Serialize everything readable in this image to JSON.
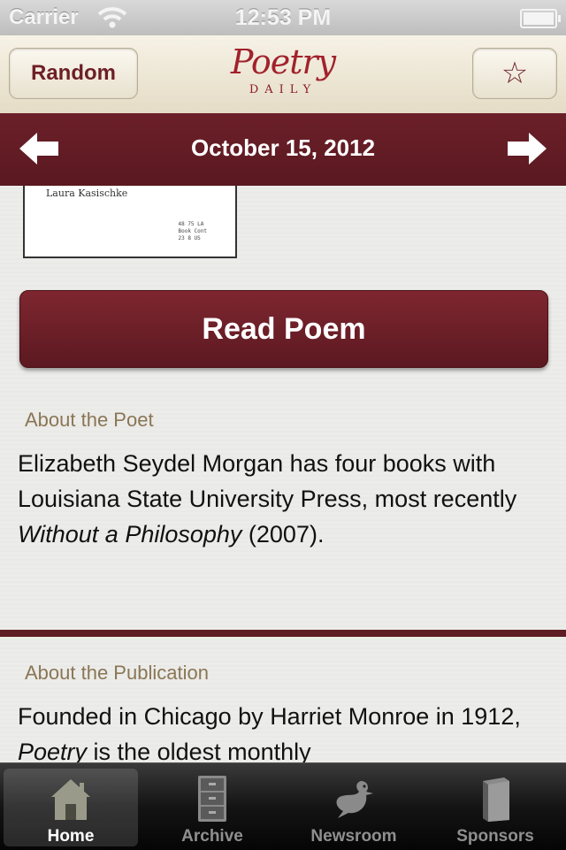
{
  "status_bar": {
    "carrier": "Carrier",
    "time": "12:53 PM"
  },
  "navbar": {
    "random_label": "Random",
    "star_glyph": "☆",
    "logo_word": "Poetry",
    "logo_sub": "DAILY"
  },
  "date_bar": {
    "date": "October 15, 2012"
  },
  "thumbnail": {
    "title": "Laura Kasischke",
    "meta_lines": [
      "48 75 LA",
      "Book Cont",
      "23 8 US"
    ]
  },
  "read_button": {
    "label": "Read Poem"
  },
  "about_poet": {
    "heading": "About the Poet",
    "text_before": "Elizabeth Seydel Morgan has four books with Louisiana State University Press, most recently ",
    "text_italic": "Without a Philosophy",
    "text_after": " (2007)."
  },
  "about_publication": {
    "heading": "About the Publication",
    "text_before": "Founded in Chicago by Harriet Monroe in 1912, ",
    "text_italic": "Poetry",
    "text_after": " is the oldest monthly"
  },
  "tabs": [
    {
      "label": "Home",
      "icon": "house-icon",
      "active": true
    },
    {
      "label": "Archive",
      "icon": "file-cabinet-icon",
      "active": false
    },
    {
      "label": "Newsroom",
      "icon": "pigeon-icon",
      "active": false
    },
    {
      "label": "Sponsors",
      "icon": "book-icon",
      "active": false
    }
  ],
  "colors": {
    "brand_maroon": "#6c2029",
    "label_tan": "#8a7655",
    "nav_cream": "#f6f2e6"
  }
}
